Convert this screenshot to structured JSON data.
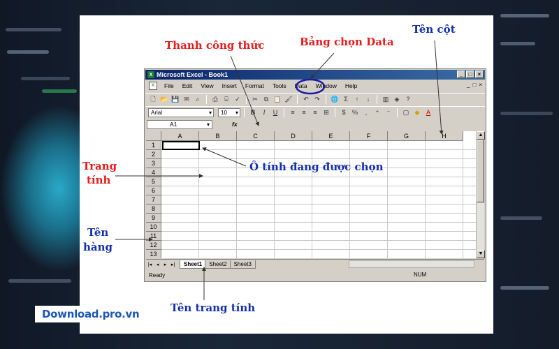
{
  "window": {
    "title": "Microsoft Excel - Book1",
    "title_buttons": [
      "_",
      "□",
      "×"
    ]
  },
  "menubar": {
    "items": [
      "File",
      "Edit",
      "View",
      "Insert",
      "Format",
      "Tools",
      "Data",
      "Window",
      "Help"
    ],
    "right_controls": [
      "_",
      "□",
      "×"
    ]
  },
  "format_toolbar": {
    "font_name": "Arial",
    "font_size": "10",
    "bold": "B",
    "italic": "I",
    "underline": "U"
  },
  "formula_bar": {
    "name_box": "A1",
    "fx_label": "fx",
    "value": ""
  },
  "grid": {
    "columns": [
      "A",
      "B",
      "C",
      "D",
      "E",
      "F",
      "G",
      "H"
    ],
    "rows": [
      "1",
      "2",
      "3",
      "4",
      "5",
      "6",
      "7",
      "8",
      "9",
      "10",
      "11",
      "12",
      "13"
    ],
    "selected_cell": "A1"
  },
  "sheets": {
    "tabs": [
      "Sheet1",
      "Sheet2",
      "Sheet3"
    ],
    "active": "Sheet1"
  },
  "status": {
    "left": "Ready",
    "num": "NUM"
  },
  "annotations": {
    "formula_bar": "Thanh công thức",
    "data_menu": "Bảng chọn Data",
    "column_name": "Tên cột",
    "worksheet": "Trang\ntính",
    "worksheet_line1": "Trang",
    "worksheet_line2": "tính",
    "selected_cell": "Ô tính đang được chọn",
    "row_name_line1": "Tên",
    "row_name_line2": "hàng",
    "sheet_name": "Tên trang tính"
  },
  "watermark": "Download.pro.vn",
  "colors": {
    "annotation_red": "#e21d1d",
    "annotation_blue": "#1531a8",
    "excel_titlebar": "#0a246a",
    "highlight_circle": "#1a1aa8"
  }
}
